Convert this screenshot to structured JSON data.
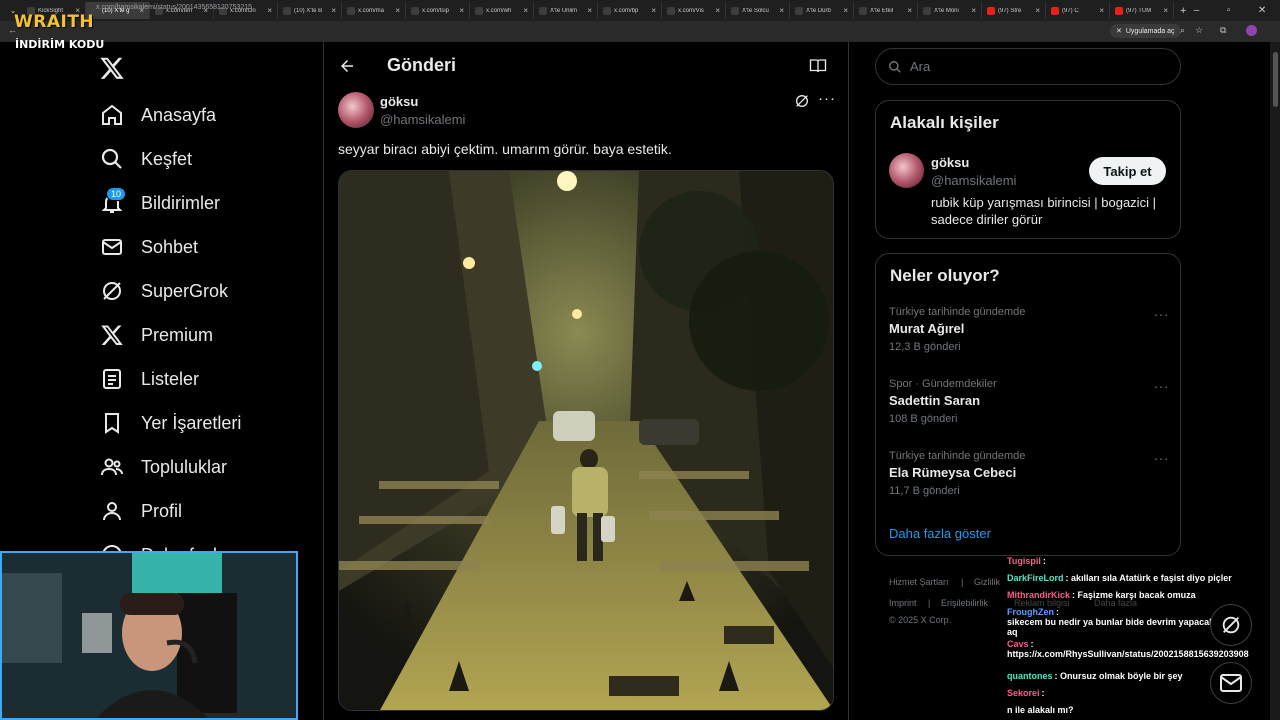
{
  "browser": {
    "tabs": [
      {
        "label": "KickSight",
        "icon": "kick-icon"
      },
      {
        "label": "(10) X'te g",
        "icon": "x-icon",
        "active": true
      },
      {
        "label": "x.com/ten",
        "icon": "x-icon"
      },
      {
        "label": "x.com/Ori",
        "icon": "x-icon"
      },
      {
        "label": "(10) X'te B",
        "icon": "x-icon"
      },
      {
        "label": "x.com/ma",
        "icon": "x-icon"
      },
      {
        "label": "x.com/tsip",
        "icon": "x-icon"
      },
      {
        "label": "x.com/wh",
        "icon": "x-icon"
      },
      {
        "label": "X'te Unlim",
        "icon": "x-icon"
      },
      {
        "label": "x.com/bp",
        "icon": "x-icon"
      },
      {
        "label": "x.com/Vis",
        "icon": "x-icon"
      },
      {
        "label": "X'te Solcu",
        "icon": "x-icon"
      },
      {
        "label": "X'te Dürb",
        "icon": "x-icon"
      },
      {
        "label": "X'te Etkil",
        "icon": "x-icon"
      },
      {
        "label": "X'te Moni",
        "icon": "x-icon"
      },
      {
        "label": "(97) Stre",
        "icon": "youtube-icon"
      },
      {
        "label": "(97) C",
        "icon": "youtube-icon"
      },
      {
        "label": "(97) TÜM",
        "icon": "youtube-icon"
      }
    ],
    "url": "x.com/hamsikalemi/status/2001435658120753215",
    "open_app_label": "Uygulamada aç"
  },
  "overlay": {
    "brand": "WRAITH",
    "promo": "İNDİRİM KODU"
  },
  "nav": {
    "items": [
      {
        "label": "Anasayfa",
        "icon": "home-icon"
      },
      {
        "label": "Keşfet",
        "icon": "search-icon"
      },
      {
        "label": "Bildirimler",
        "icon": "bell-icon"
      },
      {
        "label": "Sohbet",
        "icon": "mail-icon"
      },
      {
        "label": "SuperGrok",
        "icon": "grok-icon"
      },
      {
        "label": "Premium",
        "icon": "x-icon"
      },
      {
        "label": "Listeler",
        "icon": "list-icon"
      },
      {
        "label": "Yer İşaretleri",
        "icon": "bookmark-icon"
      },
      {
        "label": "Topluluklar",
        "icon": "people-icon"
      },
      {
        "label": "Profil",
        "icon": "person-icon"
      },
      {
        "label": "Daha fazla",
        "icon": "more-icon"
      }
    ],
    "notif_count": "10"
  },
  "post": {
    "header_title": "Gönderi",
    "author_name": "göksu",
    "author_handle": "@hamsikalemi",
    "text": "seyyar biracı abiyi çektim. umarım görür. baya estetik."
  },
  "right": {
    "search_placeholder": "Ara",
    "related_title": "Alakalı kişiler",
    "related_person": {
      "name": "göksu",
      "handle": "@hamsikalemi",
      "bio": "rubik küp yarışması birincisi | bogazici | sadece diriler görür",
      "follow_label": "Takip et"
    },
    "trends_title": "Neler oluyor?",
    "trends": [
      {
        "context": "Türkiye tarihinde gündemde",
        "name": "Murat Ağırel",
        "count": "12,3 B gönderi"
      },
      {
        "context": "Spor · Gündemdekiler",
        "name": "Sadettin Saran",
        "count": "108 B gönderi"
      },
      {
        "context": "Türkiye tarihinde gündemde",
        "name": "Ela Rümeysa Cebeci",
        "count": "11,7 B gönderi"
      }
    ],
    "show_more": "Daha fazla göster",
    "footer": {
      "terms": "Hizmet Şartları",
      "privacy": "Gizlilik",
      "imprint": "Imprint",
      "accessibility": "Erişilebilirlik",
      "ad_info": "Reklam bilgisi",
      "more": "Daha fazla",
      "copyright": "© 2025 X Corp."
    }
  },
  "chat": [
    {
      "user": "Tugispil",
      "user_color": "#ff5a8a",
      "message": ""
    },
    {
      "user": "DarkFireLord",
      "user_color": "#5ee0c8",
      "message": "akılları sıla Atatürk e faşist diyo piçler"
    },
    {
      "user": "MithrandirKick",
      "user_color": "#ff5a8a",
      "message": "Faşizme karşı bacak omuza"
    },
    {
      "user": "FroughZen",
      "user_color": "#5aa0ff",
      "message": "sikecem bu nedir ya bunlar bide devrim yapacaklar aq"
    },
    {
      "user": "Cavs",
      "user_color": "#ff5a8a",
      "message": "https://x.com/RhysSullivan/status/2002158815639203908"
    },
    {
      "user": "quantones",
      "user_color": "#5ee0c8",
      "message": "Onursuz olmak böyle bir şey"
    },
    {
      "user": "Sekorei",
      "user_color": "#ff5a8a",
      "message": ""
    },
    {
      "user": "",
      "user_color": "#ffffff",
      "message": "n ile alakalı mı?"
    }
  ],
  "colors": {
    "accent": "#1d9bf0",
    "background": "#000000",
    "border": "#2f3336",
    "muted": "#71767b"
  }
}
